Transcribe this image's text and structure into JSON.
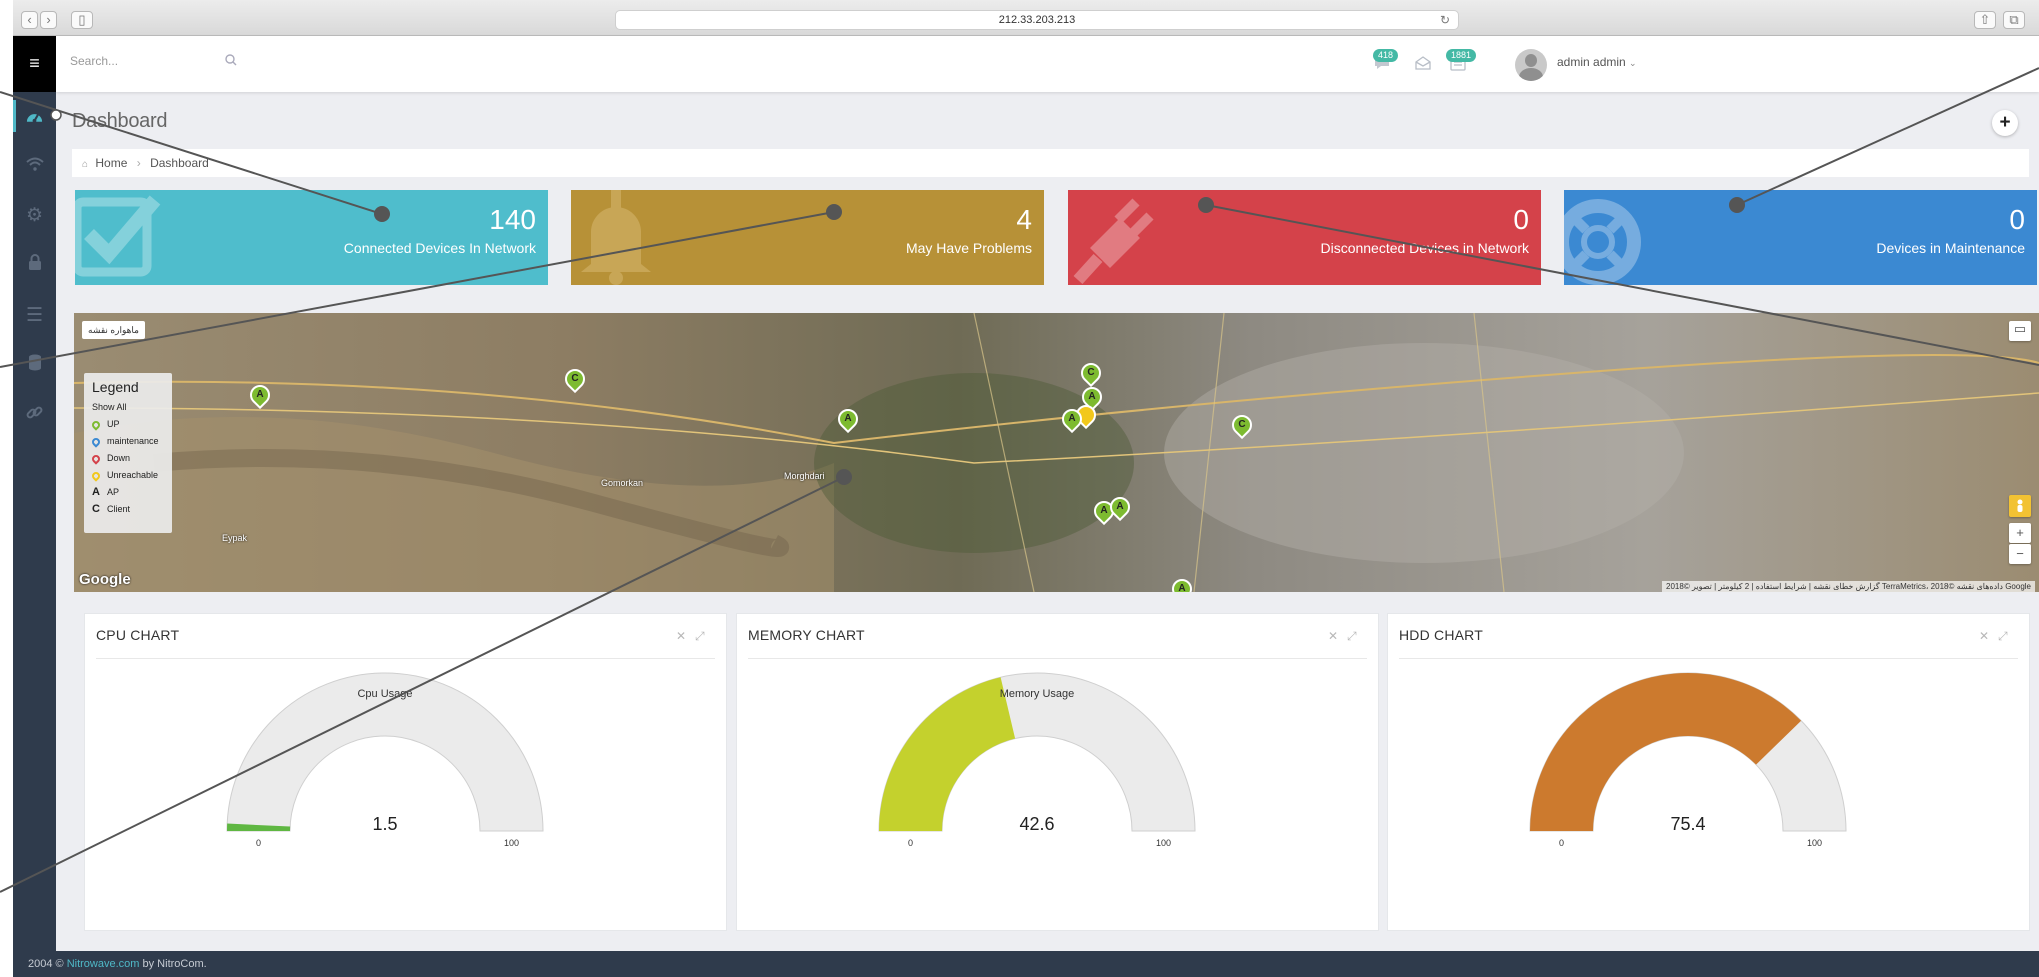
{
  "browser": {
    "url": "212.33.203.213"
  },
  "search": {
    "placeholder": "Search..."
  },
  "header": {
    "messages_badge": "418",
    "tasks_badge": "1881",
    "user_name": "admin admin"
  },
  "page": {
    "title": "Dashboard"
  },
  "breadcrumb": {
    "home": "Home",
    "current": "Dashboard"
  },
  "stats": [
    {
      "value": "140",
      "label": "Connected Devices In Network",
      "color": "#4fbdcc"
    },
    {
      "value": "4",
      "label": "May Have Problems",
      "color": "#b79137"
    },
    {
      "value": "0",
      "label": "Disconnected Devices in Network",
      "color": "#d4424a"
    },
    {
      "value": "0",
      "label": "Devices in Maintenance",
      "color": "#3b89d2"
    }
  ],
  "map": {
    "type_toggle": "ماهواره نقشه",
    "legend": {
      "title": "Legend",
      "show_all": "Show All",
      "up": "UP",
      "maintenance": "maintenance",
      "down": "Down",
      "unreachable": "Unreachable",
      "ap": "AP",
      "client": "Client"
    },
    "place_gomorkan": "Gomorkan",
    "place_morghdari": "Morghdari",
    "place_evpak": "Eypak",
    "google": "Google",
    "copyright": "گزارش خطای نقشه | شرایط استفاده | 2 کیلومتر | تصویر ©2018 TerraMetrics، داده‌های نقشه ©2018 Google"
  },
  "charts": {
    "cpu": {
      "title": "CPU CHART",
      "gauge_label": "Cpu Usage",
      "value": 1.5,
      "value_text": "1.5",
      "min": "0",
      "max": "100",
      "color": "#5fb742"
    },
    "memory": {
      "title": "MEMORY CHART",
      "gauge_label": "Memory Usage",
      "value": 42.6,
      "value_text": "42.6",
      "min": "0",
      "max": "100",
      "color": "#c4d12d"
    },
    "hdd": {
      "title": "HDD CHART",
      "gauge_label": "",
      "value": 75.4,
      "value_text": "75.4",
      "min": "0",
      "max": "100",
      "color": "#cc7a2e"
    }
  },
  "footer": {
    "prefix": "2004 © ",
    "link": "Nitrowave.com",
    "suffix": " by NitroCom."
  }
}
